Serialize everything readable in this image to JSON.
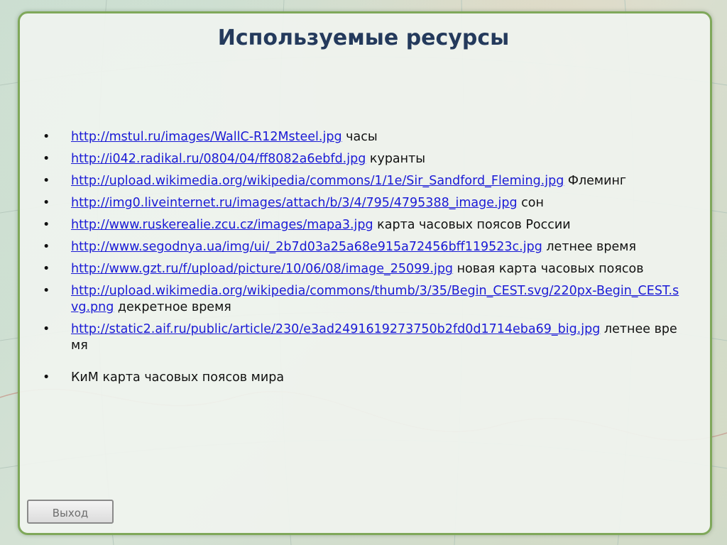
{
  "slide": {
    "title": "Используемые ресурсы"
  },
  "resources": [
    {
      "bullet": "•",
      "url": "http://mstul.ru/images/WallC-R12Msteel.jpg",
      "desc": " часы"
    },
    {
      "bullet": "•",
      "url": "http://i042.radikal.ru/0804/04/ff8082a6ebfd.jpg",
      "desc": " куранты"
    },
    {
      "bullet": "•",
      "url": "http://upload.wikimedia.org/wikipedia/commons/1/1e/Sir_Sandford_Fleming.jpg",
      "desc": " Флеминг"
    },
    {
      "bullet": "•",
      "url": "http://img0.liveinternet.ru/images/attach/b/3/4/795/4795388_image.jpg",
      "desc": " сон"
    },
    {
      "bullet": "•",
      "url": "http://www.ruskerealie.zcu.cz/images/mapa3.jpg",
      "desc": " карта часовых поясов России"
    },
    {
      "bullet": "•",
      "url": "http://www.segodnya.ua/img/ui/_2b7d03a25a68e915a72456bff119523c.jpg",
      "desc": " летнее время"
    },
    {
      "bullet": "•",
      "url": "http://www.gzt.ru/f/upload/picture/10/06/08/image_25099.jpg",
      "desc": " новая карта часовых поясов"
    },
    {
      "bullet": "•",
      "url": "http://upload.wikimedia.org/wikipedia/commons/thumb/3/35/Begin_CEST.svg/220px-Begin_CEST.svg.png",
      "desc": "  декретное время"
    },
    {
      "bullet": "•",
      "url": "http://static2.aif.ru/public/article/230/e3ad2491619273750b2fd0d1714eba69_big.jpg",
      "desc": " летнее время"
    }
  ],
  "footer_item": {
    "bullet": "•",
    "text": "КиМ карта часовых поясов мира"
  },
  "controls": {
    "exit_label": "Выход"
  },
  "colors": {
    "title": "#243a5c",
    "link": "#1a1ad6",
    "panel_border": "#7fa85a"
  }
}
